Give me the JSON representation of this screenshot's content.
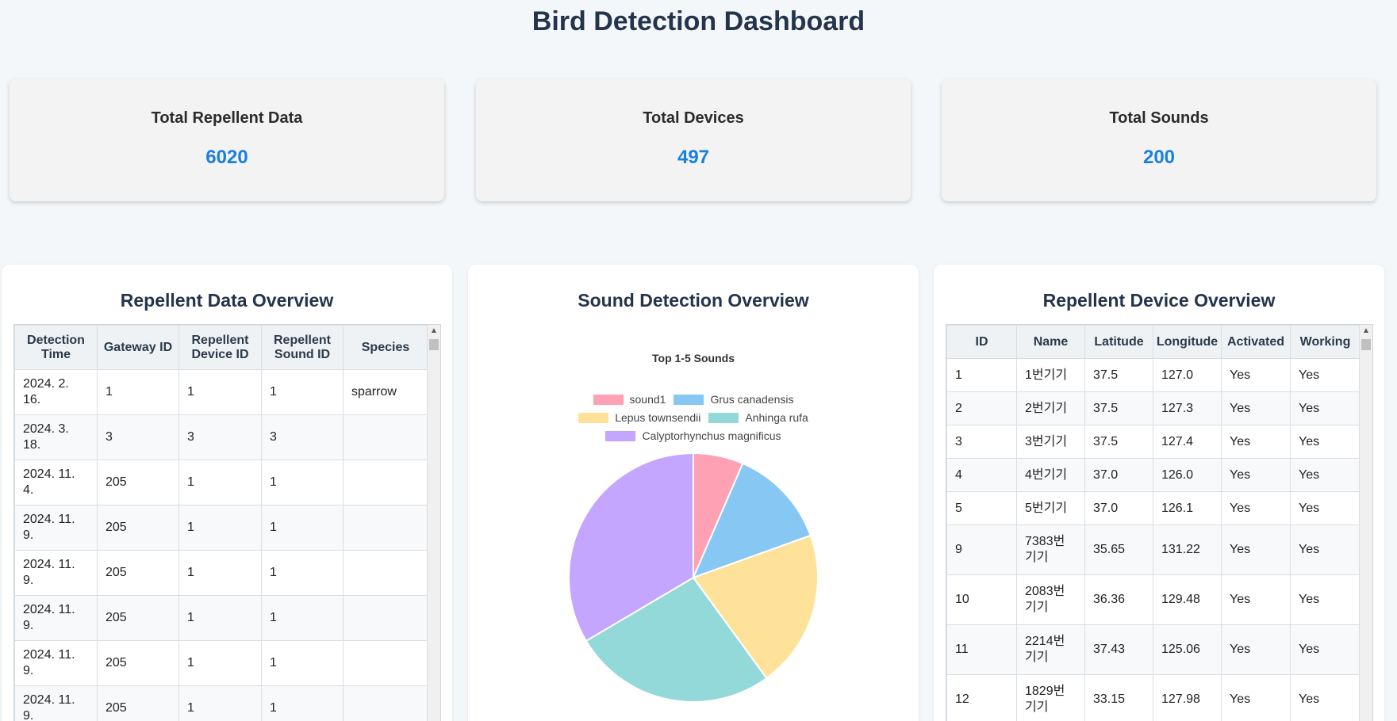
{
  "page": {
    "title": "Bird Detection Dashboard"
  },
  "stats": [
    {
      "title": "Total Repellent Data",
      "value": "6020"
    },
    {
      "title": "Total Devices",
      "value": "497"
    },
    {
      "title": "Total Sounds",
      "value": "200"
    }
  ],
  "repellent_panel": {
    "title": "Repellent Data Overview",
    "columns": [
      "Detection Time",
      "Gateway ID",
      "Repellent Device ID",
      "Repellent Sound ID",
      "Species"
    ],
    "rows": [
      [
        "2024. 2. 16.",
        "1",
        "1",
        "1",
        "sparrow"
      ],
      [
        "2024. 3. 18.",
        "3",
        "3",
        "3",
        ""
      ],
      [
        "2024. 11. 4.",
        "205",
        "1",
        "1",
        ""
      ],
      [
        "2024. 11. 9.",
        "205",
        "1",
        "1",
        ""
      ],
      [
        "2024. 11. 9.",
        "205",
        "1",
        "1",
        ""
      ],
      [
        "2024. 11. 9.",
        "205",
        "1",
        "1",
        ""
      ],
      [
        "2024. 11. 9.",
        "205",
        "1",
        "1",
        ""
      ],
      [
        "2024. 11. 9.",
        "205",
        "1",
        "1",
        ""
      ]
    ]
  },
  "sound_panel": {
    "title": "Sound Detection Overview",
    "chart_title": "Top 1-5 Sounds"
  },
  "chart_data": {
    "type": "pie",
    "title": "Top 1-5 Sounds",
    "labels": [
      "sound1",
      "Grus canadensis",
      "Lepus townsendii",
      "Anhinga rufa",
      "Calyptorhynchus magnificus"
    ],
    "values": [
      6.5,
      13,
      20.5,
      26.5,
      33.5
    ],
    "colors": [
      "#ffa1b5",
      "#86c7f3",
      "#ffe29a",
      "#93d9d9",
      "#c4a5ff"
    ],
    "legend": "top"
  },
  "device_panel": {
    "title": "Repellent Device Overview",
    "columns": [
      "ID",
      "Name",
      "Latitude",
      "Longitude",
      "Activated",
      "Working"
    ],
    "rows": [
      [
        "1",
        "1번기기",
        "37.5",
        "127.0",
        "Yes",
        "Yes"
      ],
      [
        "2",
        "2번기기",
        "37.5",
        "127.3",
        "Yes",
        "Yes"
      ],
      [
        "3",
        "3번기기",
        "37.5",
        "127.4",
        "Yes",
        "Yes"
      ],
      [
        "4",
        "4번기기",
        "37.0",
        "126.0",
        "Yes",
        "Yes"
      ],
      [
        "5",
        "5번기기",
        "37.0",
        "126.1",
        "Yes",
        "Yes"
      ],
      [
        "9",
        "7383번기기",
        "35.65",
        "131.22",
        "Yes",
        "Yes"
      ],
      [
        "10",
        "2083번기기",
        "36.36",
        "129.48",
        "Yes",
        "Yes"
      ],
      [
        "11",
        "2214번기기",
        "37.43",
        "125.06",
        "Yes",
        "Yes"
      ],
      [
        "12",
        "1829번기기",
        "33.15",
        "127.98",
        "Yes",
        "Yes"
      ]
    ]
  },
  "icons": {
    "scroll_up": "scroll-up-arrow-icon",
    "scroll_down": "scroll-down-arrow-icon"
  }
}
